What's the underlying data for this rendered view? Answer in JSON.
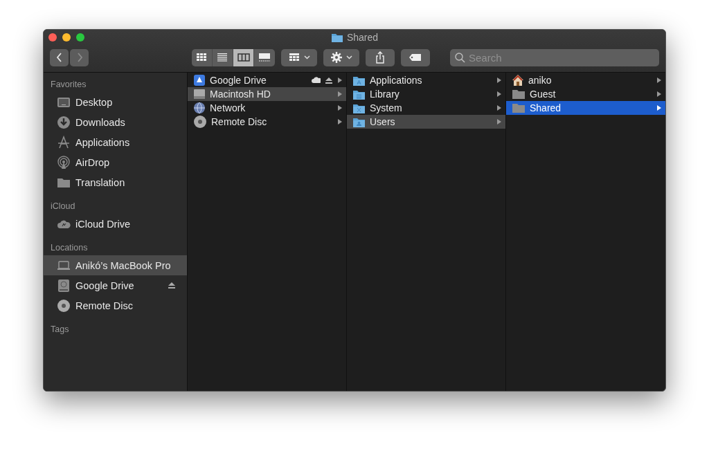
{
  "window": {
    "title": "Shared"
  },
  "toolbar": {
    "navigation": [
      {
        "kind": "back",
        "disabled": false
      },
      {
        "kind": "forward",
        "disabled": true
      }
    ],
    "view_modes": [
      {
        "kind": "icons",
        "selected": false
      },
      {
        "kind": "list",
        "selected": false
      },
      {
        "kind": "columns",
        "selected": true
      },
      {
        "kind": "gallery",
        "selected": false
      }
    ],
    "search": {
      "placeholder": "Search"
    }
  },
  "sidebar": {
    "sections": [
      {
        "title": "Favorites",
        "items": [
          {
            "label": "Desktop",
            "kind": "desktop",
            "selected": false,
            "ejectable": false
          },
          {
            "label": "Downloads",
            "kind": "downloads",
            "selected": false,
            "ejectable": false
          },
          {
            "label": "Applications",
            "kind": "applications",
            "selected": false,
            "ejectable": false
          },
          {
            "label": "AirDrop",
            "kind": "airdrop",
            "selected": false,
            "ejectable": false
          },
          {
            "label": "Translation",
            "kind": "folder",
            "selected": false,
            "ejectable": false
          }
        ]
      },
      {
        "title": "iCloud",
        "items": [
          {
            "label": "iCloud Drive",
            "kind": "cloud",
            "selected": false,
            "ejectable": false
          }
        ]
      },
      {
        "title": "Locations",
        "items": [
          {
            "label": "Anikó’s MacBook Pro",
            "kind": "laptop",
            "selected": true,
            "ejectable": false
          },
          {
            "label": "Google Drive",
            "kind": "drive",
            "selected": false,
            "ejectable": true
          },
          {
            "label": "Remote Disc",
            "kind": "disc",
            "selected": false,
            "ejectable": false
          }
        ]
      },
      {
        "title": "Tags"
      }
    ]
  },
  "columns": [
    {
      "active": false,
      "items": [
        {
          "label": "Google Drive",
          "kind": "gdrive",
          "selected": false,
          "synced": true,
          "ejectable": true
        },
        {
          "label": "Macintosh HD",
          "kind": "hd",
          "selected": true,
          "synced": false,
          "ejectable": false
        },
        {
          "label": "Network",
          "kind": "network",
          "selected": false,
          "synced": false,
          "ejectable": false
        },
        {
          "label": "Remote Disc",
          "kind": "disc",
          "selected": false,
          "synced": false,
          "ejectable": false
        }
      ]
    },
    {
      "active": false,
      "items": [
        {
          "label": "Applications",
          "kind": "folder-apps",
          "selected": false,
          "synced": false,
          "ejectable": false
        },
        {
          "label": "Library",
          "kind": "folder-library",
          "selected": false,
          "synced": false,
          "ejectable": false
        },
        {
          "label": "System",
          "kind": "folder-system",
          "selected": false,
          "synced": false,
          "ejectable": false
        },
        {
          "label": "Users",
          "kind": "folder-users",
          "selected": true,
          "synced": false,
          "ejectable": false
        }
      ]
    },
    {
      "active": true,
      "items": [
        {
          "label": "aniko",
          "kind": "home",
          "selected": false,
          "synced": false,
          "ejectable": false
        },
        {
          "label": "Guest",
          "kind": "folder",
          "selected": false,
          "synced": false,
          "ejectable": false
        },
        {
          "label": "Shared",
          "kind": "folder",
          "selected": true,
          "synced": false,
          "ejectable": false
        }
      ]
    }
  ]
}
